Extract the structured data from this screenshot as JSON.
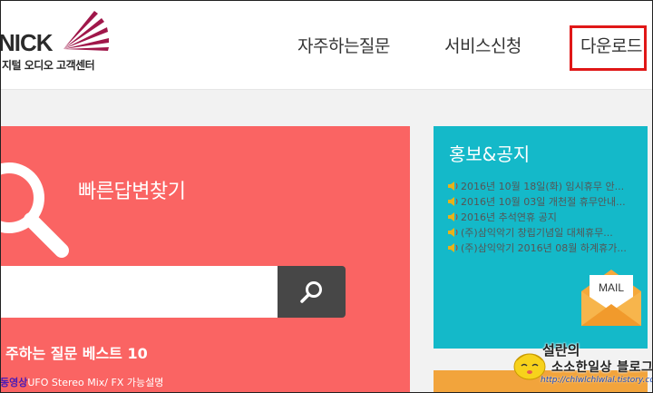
{
  "logo": {
    "text": "nick",
    "subtitle": "지털 오디오 고객센터"
  },
  "nav": {
    "faq": "자주하는질문",
    "service": "서비스신청",
    "download": "다운로드"
  },
  "search": {
    "title": "빠른답변찾기",
    "placeholder": "",
    "best_title": "주하는 질문 베스트 10",
    "best_items": [
      {
        "tag": "동영상",
        "text": "UFO Stereo Mix/ FX 가능설명"
      }
    ]
  },
  "notice": {
    "title": "홍보&공지",
    "items": [
      "2016년 10월 18일(화) 임시휴무 안...",
      "2016년 10월 03일 개천절 휴무안내...",
      "2016년 추석연휴 공지",
      "(주)삼익악기 창립기념일 대체휴무...",
      "(주)삼익악기 2016년 08월 하계휴가..."
    ],
    "mail_label": "MAIL"
  },
  "watermark": {
    "line1": "설란의",
    "line2": "소소한일상 블로그",
    "url": "http://chlwlchlwlal.tistory.com"
  },
  "colors": {
    "red_panel": "#fa6463",
    "teal_panel": "#14b9c9",
    "highlight": "#e01717",
    "search_button": "#474747"
  }
}
